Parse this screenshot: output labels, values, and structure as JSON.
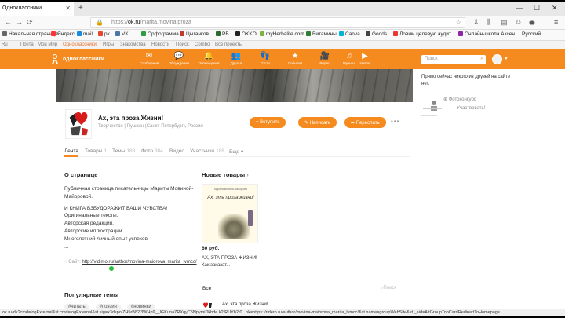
{
  "browser": {
    "tab_title": "Одноклассники",
    "url_prefix": "https://",
    "url_domain": "ok.ru",
    "url_path": "/marita.movina.proza",
    "bookmarks": [
      {
        "label": "Начальная страница",
        "color": "#666666"
      },
      {
        "label": "Яндекс",
        "color": "#ff3333"
      },
      {
        "label": "mail",
        "color": "#168de2"
      },
      {
        "label": "pk",
        "color": "#e5472d"
      },
      {
        "label": "VK",
        "color": "#4a76a8"
      },
      {
        "label": "Орфограмма",
        "color": "#2e9e45"
      },
      {
        "label": "Цыганков.",
        "color": "#c0392b"
      },
      {
        "label": "РБ",
        "color": "#2d6a2d"
      },
      {
        "label": "OKKO",
        "color": "#222222"
      },
      {
        "label": "myHerbalife.com",
        "color": "#7cb342"
      },
      {
        "label": "Витамины",
        "color": "#2e7d32"
      },
      {
        "label": "Canva",
        "color": "#00b4d8"
      },
      {
        "label": "Goods",
        "color": "#444444"
      },
      {
        "label": "Ловим целевую аудит...",
        "color": "#e53935"
      },
      {
        "label": "Онлайн-школа Аксен...",
        "color": "#8e24aa"
      }
    ],
    "bookmark_lang": "Русский"
  },
  "menubar": [
    {
      "label": "Ru"
    },
    {
      "label": "Почта"
    },
    {
      "label": "Мой Мир"
    },
    {
      "label": "Одноклассники",
      "active": true
    },
    {
      "label": "Игры"
    },
    {
      "label": "Знакомства"
    },
    {
      "label": "Новости"
    },
    {
      "label": "Поиск"
    },
    {
      "label": "Combo"
    },
    {
      "label": "Все проекты"
    }
  ],
  "okheader": {
    "title": "одноклассники",
    "nav": [
      {
        "label": "Сообщения",
        "icon": "message-icon",
        "glyph": "✉"
      },
      {
        "label": "Обсуждения",
        "icon": "discussion-icon",
        "glyph": "💬"
      },
      {
        "label": "Оповещения",
        "icon": "bell-icon",
        "glyph": "🔔"
      },
      {
        "label": "Друзья",
        "icon": "friends-icon",
        "glyph": "👥"
      },
      {
        "label": "Гости",
        "icon": "footprint-icon",
        "glyph": "👣"
      },
      {
        "label": "События",
        "icon": "events-icon",
        "glyph": "★"
      },
      {
        "label": "Видео",
        "icon": "video-icon",
        "glyph": "🎥"
      },
      {
        "label": "Музыка",
        "icon": "music-icon",
        "glyph": "♫"
      },
      {
        "label": "Новое",
        "icon": "play-icon",
        "glyph": "▶"
      }
    ],
    "search_placeholder": "Поиск"
  },
  "right_col": {
    "online_text": "Прямо сейчас никого из друзей на сайте нет.",
    "contest": "Фотоконкурс",
    "participate": "Участвовать!"
  },
  "group": {
    "name": "Ах, эта проза Жизни!",
    "subtitle": "Творчество  |  Пушкин (Санкт-Петербург), Россия",
    "btn_join": "+ Вступить",
    "btn_write": "Написать",
    "btn_share": "Переслать",
    "accent": "#f58b1f"
  },
  "group_tabs": [
    {
      "label": "Лента",
      "count": "",
      "active": true
    },
    {
      "label": "Товары",
      "count": "1"
    },
    {
      "label": "Темы",
      "count": "183"
    },
    {
      "label": "Фото",
      "count": "384"
    },
    {
      "label": "Видео",
      "count": ""
    },
    {
      "label": "Участники",
      "count": "188"
    },
    {
      "label": "Еще",
      "count": ""
    }
  ],
  "about": {
    "title": "О странице",
    "p1": "Публичная страница писательницы Мариты Мовиной-Майоровой.",
    "p2": "И КНИГА ВЗБУДОРАЖИТ ВАШИ ЧУВСТВА!",
    "p3": "Оригинальные тексты.",
    "p4": "Авторская редакция.",
    "p5": "Авторские иллюстрации.",
    "p6": "Многолетний личный опыт успехов",
    "p7": "...",
    "site_label": "Сайт:",
    "site_link": "http://vidimo.ru/author/movina-maiorova_marita_lvmcc/"
  },
  "products": {
    "title": "Новые товары",
    "card_author": "марита мовина-майорова",
    "card_title": "Ах, эта проза жизни!",
    "price": "60 руб.",
    "name": "АХ, ЭТА ПРОЗА ЖИЗНИ! Как заказат..."
  },
  "feed": {
    "all_label": "Все",
    "search_label": "Поиск",
    "item_text": "Ах, эта проза Жизни!"
  },
  "popular": {
    "title": "Популярные темы",
    "tags": [
      "#читать",
      "#поэзия",
      "#новинки"
    ]
  },
  "status_url": "ok.ru/dk?cmd=logExternal&st.cmd=logExternal&st.sig=x3dspoiZH5rB82l3WHp9__lGKunaZRXqyC5NpymiDkbde.k2fRUYb2t0...nk=https://ridero.ru/author/movina-maiorova_marita_lvmcc/&st.name=groupWebSite&st._aid=AltGroupTopCardRedirectToHomepage"
}
